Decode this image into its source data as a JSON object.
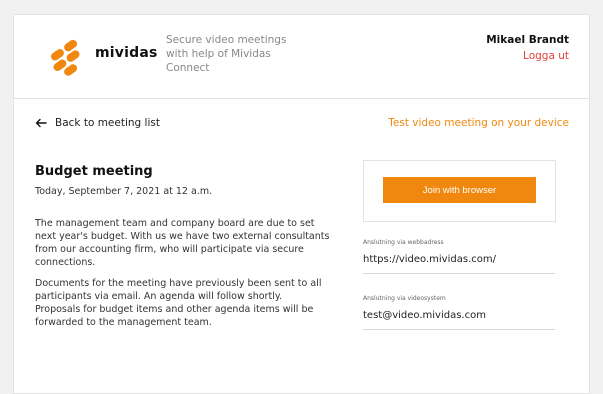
{
  "header": {
    "logo_text": "mividas",
    "tagline": "Secure video meetings with help of Mividas Connect",
    "user_name": "Mikael Brandt",
    "logout_label": "Logga ut"
  },
  "nav": {
    "back_label": "Back to meeting list",
    "test_label": "Test video meeting on your device"
  },
  "meeting": {
    "title": "Budget meeting",
    "date": "Today, September 7, 2021 at 12 a.m.",
    "paragraphs": [
      "The management team and company board are due to set next year's budget. With us we have two external consultants from our accounting firm, who will participate via secure connections.",
      "Documents for the meeting have previously been sent to all participants via email. An agenda will follow shortly. Proposals for budget items and other agenda items will be forwarded to the management team."
    ]
  },
  "join": {
    "button_label": "Join with browser",
    "web_label": "Anslutning via webbadress",
    "web_value": "https://video.mividas.com/",
    "video_label": "Anslutning via videosystem",
    "video_value": "test@video.mividas.com"
  },
  "colors": {
    "accent": "#f0880f",
    "logout": "#e0413a"
  }
}
